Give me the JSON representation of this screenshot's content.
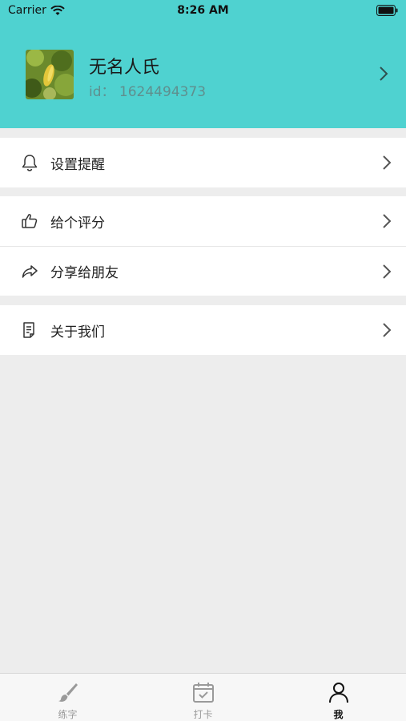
{
  "status_bar": {
    "carrier": "Carrier",
    "time": "8:26 AM"
  },
  "profile": {
    "name": "无名人氏",
    "id_text": "id：  1624494373"
  },
  "menu": {
    "remind": "设置提醒",
    "rate": "给个评分",
    "share": "分享给朋友",
    "about": "关于我们"
  },
  "tabs": [
    "练字",
    "打卡",
    "我"
  ],
  "colors": {
    "header": "#4fd2d0",
    "background": "#ededed"
  }
}
